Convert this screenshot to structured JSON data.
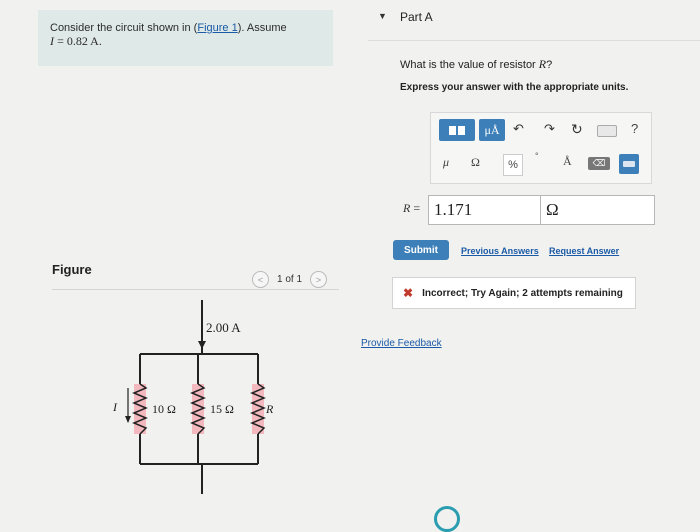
{
  "problem": {
    "text_before_link": "Consider the circuit shown in (",
    "figure_link": "Figure 1",
    "text_after_link": "). Assume",
    "current_var": "I",
    "current_value": "= 0.82 A."
  },
  "figure": {
    "label": "Figure",
    "pager_text": "1 of 1",
    "prev_arrow": "<",
    "next_arrow": ">",
    "circuit": {
      "source_current": "2.00 A",
      "branch_current": "I",
      "resistor_1": "10 Ω",
      "resistor_2": "15 Ω",
      "resistor_3": "R"
    }
  },
  "part": {
    "title": "Part A",
    "question_text": "What is the value of resistor",
    "question_var": "R",
    "question_mark": "?",
    "instruction": "Express your answer with the appropriate units."
  },
  "toolbar": {
    "units_label": "μÅ",
    "undo_icon": "↶",
    "redo_icon": "↷",
    "reset_icon": "↻",
    "help_icon": "?",
    "mu_symbol": "μ",
    "ohm_symbol": "Ω",
    "percent_symbol": "%",
    "degree_symbol": "°",
    "angstrom_symbol": "Å",
    "backspace_icon": "⌫"
  },
  "answer": {
    "var_label": "R",
    "equals": "=",
    "value": "1.171",
    "unit": "Ω"
  },
  "actions": {
    "submit": "Submit",
    "previous_answers": "Previous Answers",
    "request_answer": "Request Answer"
  },
  "feedback": {
    "icon": "✖",
    "message": "Incorrect; Try Again; 2 attempts remaining"
  },
  "footer": {
    "provide_feedback": "Provide Feedback"
  },
  "colors": {
    "accent": "#3d7fb8",
    "link": "#1a5aa6",
    "error": "#c0392b",
    "resistor_shade": "#f2b8bd"
  }
}
